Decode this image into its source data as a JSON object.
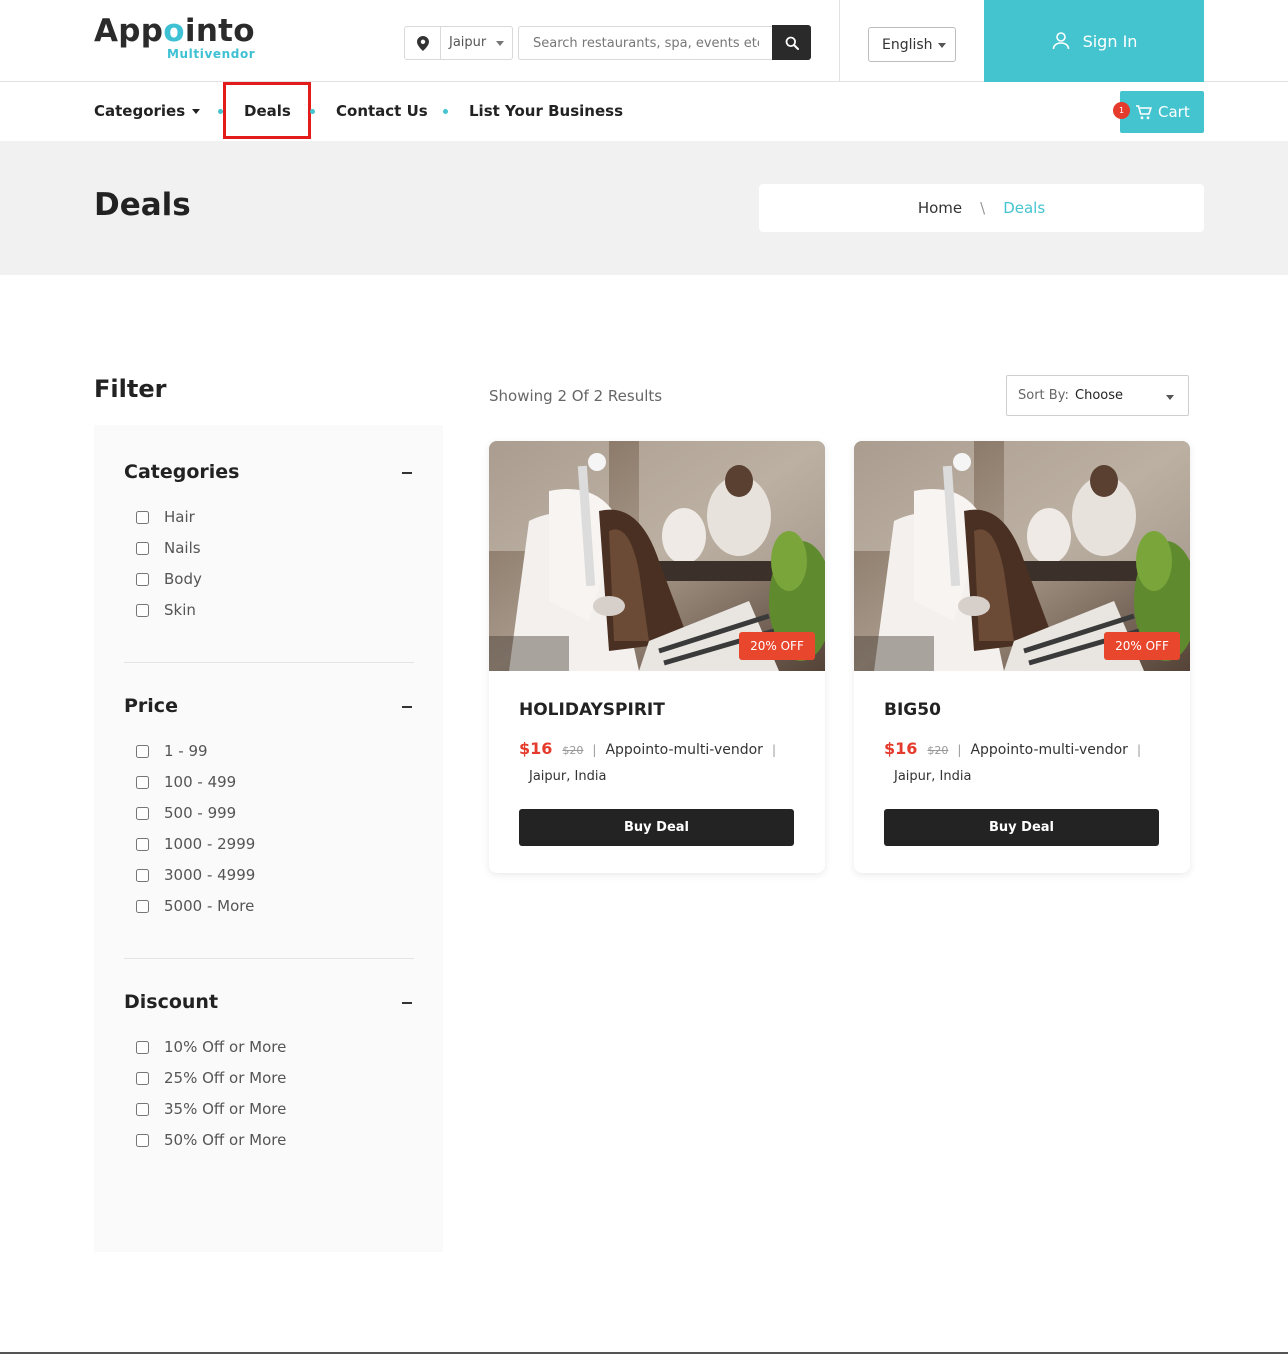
{
  "header": {
    "logo_main_prefix": "App",
    "logo_main_accent": "o",
    "logo_main_suffix": "into",
    "logo_sub": "Multivendor",
    "location": "Jaipur",
    "search_placeholder": "Search restaurants, spa, events etc...",
    "language": "English",
    "signin_label": "Sign In",
    "accent_color": "#44c4cf"
  },
  "nav": {
    "categories": "Categories",
    "deals": "Deals",
    "contact": "Contact Us",
    "list_business": "List Your Business",
    "cart_label": "Cart",
    "cart_count": "1"
  },
  "banner": {
    "title": "Deals",
    "breadcrumb_home": "Home",
    "breadcrumb_sep": "\\",
    "breadcrumb_current": "Deals"
  },
  "filter": {
    "title": "Filter",
    "groups": [
      {
        "title": "Categories",
        "options": [
          "Hair",
          "Nails",
          "Body",
          "Skin"
        ]
      },
      {
        "title": "Price",
        "options": [
          "1 - 99",
          "100 - 499",
          "500 - 999",
          "1000 - 2999",
          "3000 - 4999",
          "5000 - More"
        ]
      },
      {
        "title": "Discount",
        "options": [
          "10% Off or More",
          "25% Off or More",
          "35% Off or More",
          "50% Off or More"
        ]
      }
    ]
  },
  "results": {
    "count_text": "Showing 2 Of 2 Results",
    "sort_label": "Sort By:",
    "sort_value": "Choose"
  },
  "deals": [
    {
      "title": "HOLIDAYSPIRIT",
      "price": "$16",
      "old_price": "$20",
      "vendor": "Appointo-multi-vendor",
      "location": "Jaipur, India",
      "badge": "20% OFF",
      "button": "Buy Deal"
    },
    {
      "title": "BIG50",
      "price": "$16",
      "old_price": "$20",
      "vendor": "Appointo-multi-vendor",
      "location": "Jaipur, India",
      "badge": "20% OFF",
      "button": "Buy Deal"
    }
  ]
}
